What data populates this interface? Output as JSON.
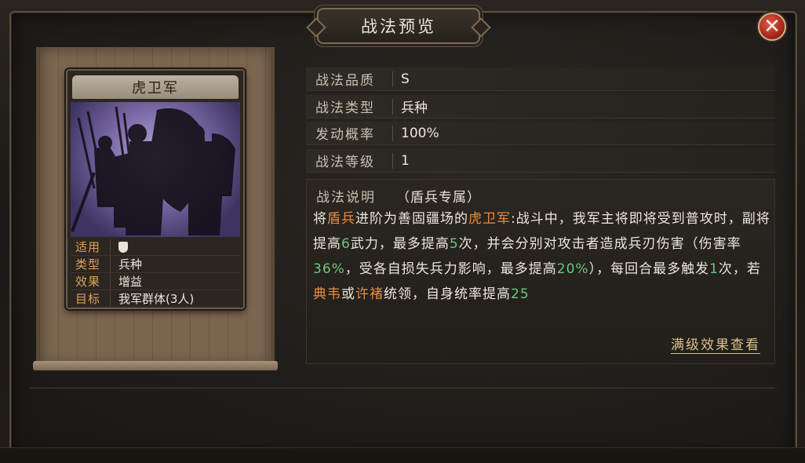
{
  "dialog": {
    "title": "战法预览",
    "close_label": "✕"
  },
  "card": {
    "title": "虎卫军",
    "icon": "soldiers-silhouette-art",
    "rows": [
      {
        "key": "适用",
        "value": "",
        "icon": "shield-icon"
      },
      {
        "key": "类型",
        "value": "兵种"
      },
      {
        "key": "效果",
        "value": "增益"
      },
      {
        "key": "目标",
        "value": "我军群体(3人)"
      }
    ]
  },
  "attributes": [
    {
      "key": "战法品质",
      "value": "S"
    },
    {
      "key": "战法类型",
      "value": "兵种"
    },
    {
      "key": "发动概率",
      "value": "100%"
    },
    {
      "key": "战法等级",
      "value": "1"
    }
  ],
  "description": {
    "label": "战法说明",
    "sub": "（盾兵专属）",
    "segments": [
      {
        "t": "将",
        "c": ""
      },
      {
        "t": "盾兵",
        "c": "o"
      },
      {
        "t": "进阶为善固疆场的",
        "c": ""
      },
      {
        "t": "虎卫军",
        "c": "o"
      },
      {
        "t": ":战斗中，我军主将即将受到普攻时，副将提高",
        "c": ""
      },
      {
        "t": "6",
        "c": "g"
      },
      {
        "t": "武力，最多提高",
        "c": ""
      },
      {
        "t": "5",
        "c": "g"
      },
      {
        "t": "次，并会分别对攻击者造成兵刃伤害（伤害率",
        "c": ""
      },
      {
        "t": "36%",
        "c": "g"
      },
      {
        "t": "，受各自损失兵力影响，最多提高",
        "c": ""
      },
      {
        "t": "20%",
        "c": "g"
      },
      {
        "t": "），每回合最多触发",
        "c": ""
      },
      {
        "t": "1",
        "c": "g"
      },
      {
        "t": "次，若",
        "c": ""
      },
      {
        "t": "典韦",
        "c": "o"
      },
      {
        "t": "或",
        "c": ""
      },
      {
        "t": "许褚",
        "c": "o"
      },
      {
        "t": "统领，自身统率提高",
        "c": ""
      },
      {
        "t": "25",
        "c": "g"
      }
    ],
    "more_label": "满级效果查看"
  },
  "colors": {
    "highlight_orange": "#f08a3a",
    "highlight_green": "#6cc77a",
    "label_gold": "#d9a25a"
  }
}
